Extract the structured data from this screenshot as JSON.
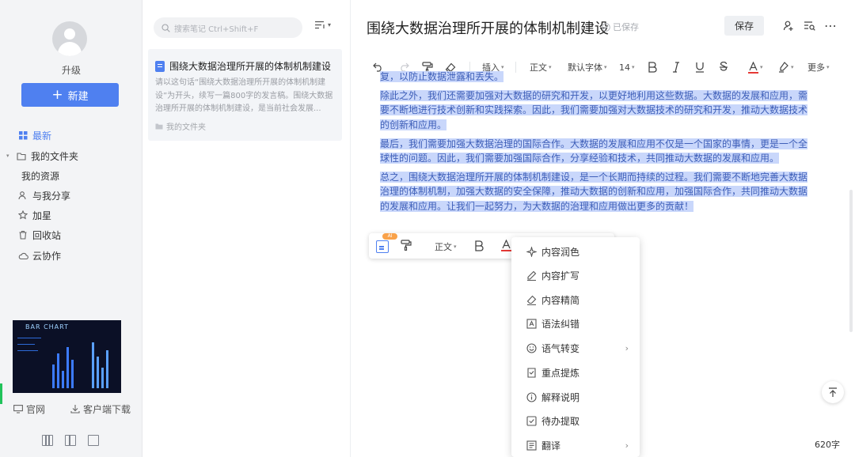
{
  "sidebar": {
    "upgrade": "升级",
    "new_button": "新建",
    "nav": [
      {
        "label": "最新",
        "icon": "grid-icon",
        "active": true
      },
      {
        "label": "我的文件夹",
        "icon": "folder-icon"
      },
      {
        "label": "我的资源",
        "icon": ""
      },
      {
        "label": "与我分享",
        "icon": "share-user-icon"
      },
      {
        "label": "加星",
        "icon": "star-icon"
      },
      {
        "label": "回收站",
        "icon": "trash-icon"
      },
      {
        "label": "云协作",
        "icon": "cloud-icon"
      }
    ],
    "thumbnail_text": "BAR CHART",
    "footer": {
      "website": "官网",
      "client_download": "客户端下载"
    }
  },
  "list": {
    "search_placeholder": "搜索笔记 Ctrl+Shift+F",
    "note": {
      "title": "围绕大数据治理所开展的体制机制建设",
      "snippet": "请以这句话“围绕大数据治理所开展的体制机制建设”为开头，续写一篇800字的发言稿。围绕大数据治理所开展的体制机制建设，是当前社会发展...",
      "folder": "我的文件夹"
    }
  },
  "editor": {
    "title": "围绕大数据治理所开展的体制机制建设",
    "saved_status": "已保存",
    "save_button": "保存",
    "toolbar": {
      "insert": "插入",
      "paragraph": "正文",
      "font": "默认字体",
      "size": "14",
      "more": "更多"
    },
    "paragraphs": [
      "复，以防止数据泄露和丢失。",
      "除此之外，我们还需要加强对大数据的研究和开发，以更好地利用这些数据。大数据的发展和应用，需要不断地进行技术创新和实践探索。因此，我们需要加强对大数据技术的研究和开发，推动大数据技术的创新和应用。",
      "最后，我们需要加强大数据治理的国际合作。大数据的发展和应用不仅是一个国家的事情，更是一个全球性的问题。因此，我们需要加强国际合作，分享经验和技术，共同推动大数据的发展和应用。",
      "总之，围绕大数据治理所开展的体制机制建设，是一个长期而持续的过程。我们需要不断地完善大数据治理的体制机制，加强大数据的安全保障，推动大数据的创新和应用，加强国际合作，共同推动大数据的发展和应用。让我们一起努力，为大数据的治理和应用做出更多的贡献！"
    ],
    "float_toolbar": {
      "ai_badge": "AI",
      "paragraph": "正文"
    },
    "ai_menu": [
      {
        "label": "内容润色",
        "icon": "sparkle-icon"
      },
      {
        "label": "内容扩写",
        "icon": "pen-icon"
      },
      {
        "label": "内容精简",
        "icon": "eraser-icon"
      },
      {
        "label": "语法纠错",
        "icon": "grammar-icon"
      },
      {
        "label": "语气转变",
        "icon": "smile-icon",
        "submenu": true
      },
      {
        "label": "重点提炼",
        "icon": "highlight-doc-icon"
      },
      {
        "label": "解释说明",
        "icon": "info-icon"
      },
      {
        "label": "待办提取",
        "icon": "checkbox-icon"
      },
      {
        "label": "翻译",
        "icon": "translate-icon",
        "submenu": true
      }
    ],
    "word_count": "620字"
  },
  "colors": {
    "accent": "#4f80f0",
    "highlight": "#c9d7fb",
    "sidebar_bg": "#f3f4f6"
  }
}
